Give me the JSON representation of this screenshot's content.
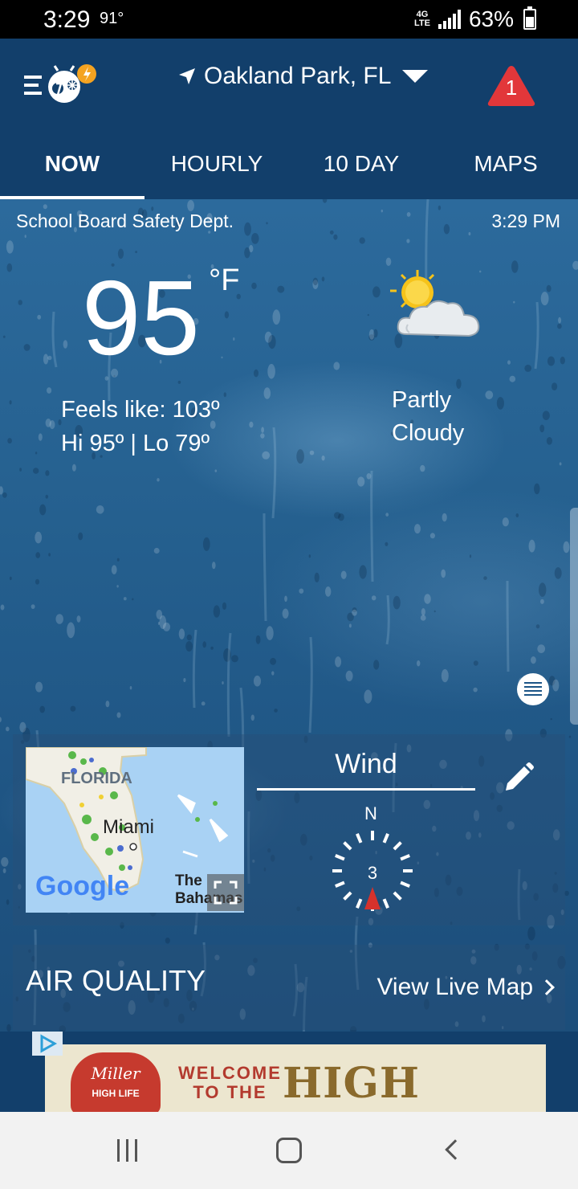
{
  "status_bar": {
    "time": "3:29",
    "temp": "91°",
    "network": "4G LTE",
    "battery": "63%"
  },
  "header": {
    "location": "Oakland Park, FL",
    "alert_count": "1",
    "tabs": [
      {
        "label": "NOW",
        "active": true
      },
      {
        "label": "HOURLY",
        "active": false
      },
      {
        "label": "10 DAY",
        "active": false
      },
      {
        "label": "MAPS",
        "active": false
      }
    ]
  },
  "current": {
    "sponsor": "School Board  Safety Dept.",
    "updated_time": "3:29 PM",
    "temperature": "95",
    "unit": "°F",
    "feels_like": "Feels like: 103º",
    "hi_lo": "Hi 95º | Lo 79º",
    "condition_line1": "Partly",
    "condition_line2": "Cloudy"
  },
  "map_card": {
    "label_state": "FLORIDA",
    "label_city": "Miami",
    "label_region_1": "The",
    "label_region_2": "Bahamas",
    "attribution": "Google"
  },
  "wind_card": {
    "title": "Wind",
    "direction_label": "N",
    "speed": "3"
  },
  "air_quality": {
    "title": "AIR QUALITY",
    "link": "View Live Map"
  },
  "ad": {
    "brand_line1": "Miller",
    "brand_line2": "HIGH LIFE",
    "welcome": "WELCOME TO THE",
    "headline": "HIGH LIFE"
  },
  "colors": {
    "header_bg": "#123f6b",
    "alert_red": "#e2373a",
    "sun_yellow": "#f6c31a",
    "wind_arrow": "#d6322c"
  }
}
